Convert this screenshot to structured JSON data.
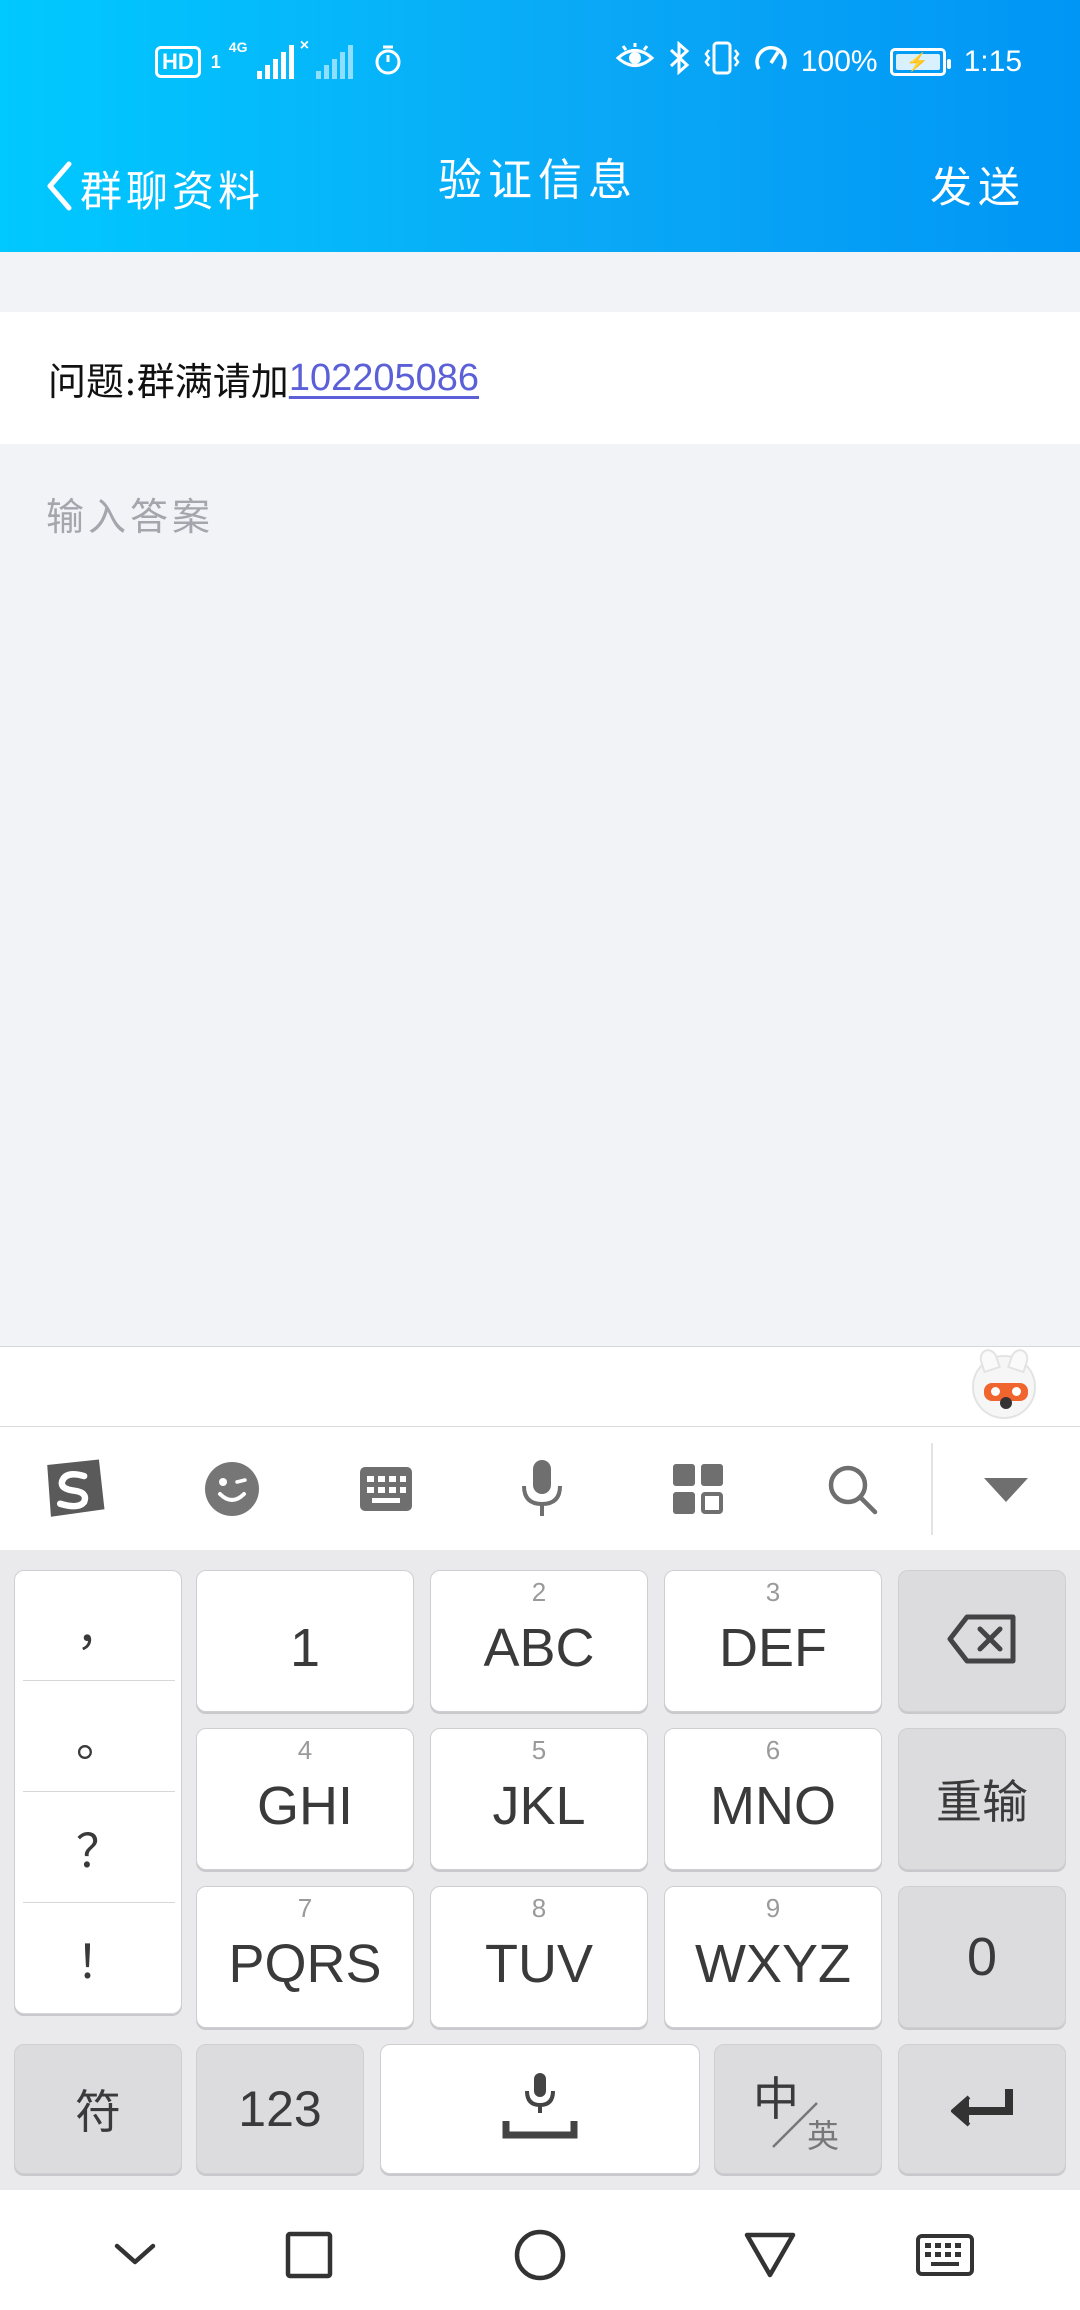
{
  "status_bar": {
    "hd_badge": "HD",
    "sim_label": "1",
    "network_type": "4G",
    "battery_percent": "100%",
    "time": "1:15"
  },
  "nav": {
    "back_label": "群聊资料",
    "title": "验证信息",
    "send_label": "发送"
  },
  "question": {
    "prefix": "问题:群满请加",
    "link_number": "102205086"
  },
  "answer": {
    "placeholder": "输入答案",
    "value": ""
  },
  "keyboard": {
    "punctuation": [
      "，",
      "。",
      "？",
      "！"
    ],
    "keys": [
      {
        "sub": "",
        "main": "1"
      },
      {
        "sub": "2",
        "main": "ABC"
      },
      {
        "sub": "3",
        "main": "DEF"
      },
      {
        "sub": "4",
        "main": "GHI"
      },
      {
        "sub": "5",
        "main": "JKL"
      },
      {
        "sub": "6",
        "main": "MNO"
      },
      {
        "sub": "7",
        "main": "PQRS"
      },
      {
        "sub": "8",
        "main": "TUV"
      },
      {
        "sub": "9",
        "main": "WXYZ"
      }
    ],
    "reenter_label": "重输",
    "zero_label": "0",
    "symbol_label": "符",
    "num_label": "123",
    "lang_main": "中",
    "lang_sub": "英"
  },
  "colors": {
    "header_start": "#00c9ff",
    "header_end": "#0096f5",
    "link": "#5b5fd8"
  }
}
